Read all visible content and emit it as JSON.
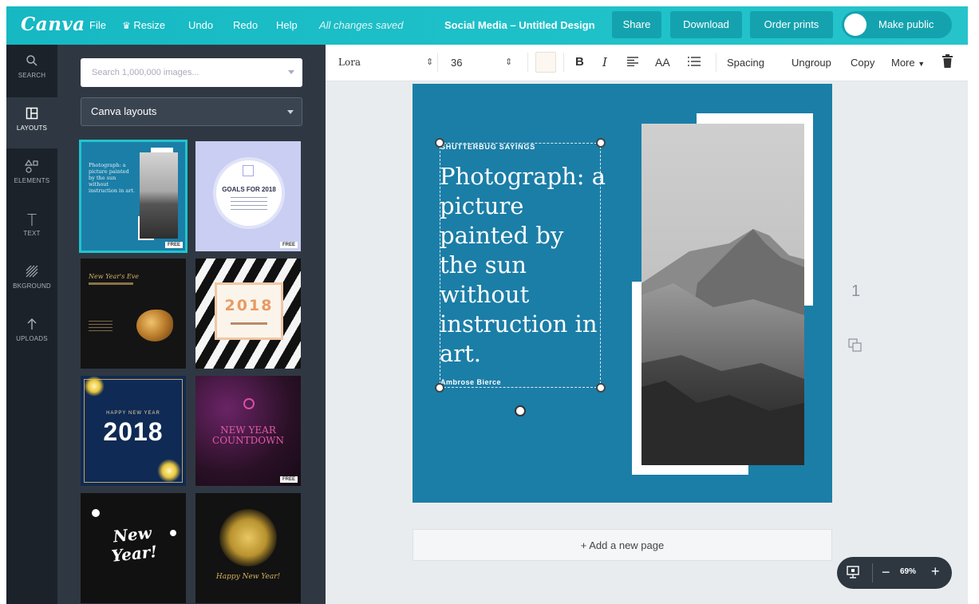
{
  "app": {
    "logo": "Canva",
    "menu": [
      "File",
      "Resize",
      "Undo",
      "Redo",
      "Help"
    ],
    "saved_status": "All changes saved",
    "design_title": "Social Media – Untitled Design",
    "buttons": {
      "share": "Share",
      "download": "Download",
      "order_prints": "Order prints",
      "make_public": "Make public"
    }
  },
  "rail": [
    {
      "label": "SEARCH",
      "icon": "search-icon"
    },
    {
      "label": "LAYOUTS",
      "icon": "layouts-icon"
    },
    {
      "label": "ELEMENTS",
      "icon": "elements-icon"
    },
    {
      "label": "TEXT",
      "icon": "text-icon"
    },
    {
      "label": "BKGROUND",
      "icon": "background-icon"
    },
    {
      "label": "UPLOADS",
      "icon": "upload-icon"
    }
  ],
  "panel": {
    "search_placeholder": "Search 1,000,000 images...",
    "layout_filter": "Canva layouts",
    "free_label": "FREE",
    "thumbnails": {
      "photograph": "Photograph: a picture painted by the sun without instruction in art.",
      "goals": "GOALS FOR 2018",
      "nye_script": "New Year's Eve",
      "year_2018_a": "2018",
      "happy_new_year": "HAPPY NEW YEAR",
      "year_2018_b": "2018",
      "countdown": "NEW YEAR COUNTDOWN",
      "new_year_script": "New Year!",
      "happy_new_year_script": "Happy New Year!"
    }
  },
  "toolbar": {
    "font": "Lora",
    "size": "36",
    "bold": "B",
    "italic": "I",
    "case": "AA",
    "spacing": "Spacing",
    "ungroup": "Ungroup",
    "copy": "Copy",
    "more": "More"
  },
  "design": {
    "caption": "SHUTTERBUG SAYINGS",
    "quote": "Photograph: a picture painted by the sun without instruction in art.",
    "author": "Ambrose Bierce",
    "page_number": "1"
  },
  "add_page": "+ Add a new page",
  "zoom": "69%",
  "colors": {
    "brand": "#1fc1c9",
    "page": "#1b7ea7",
    "panel": "#2f3842",
    "rail": "#1c2229"
  }
}
